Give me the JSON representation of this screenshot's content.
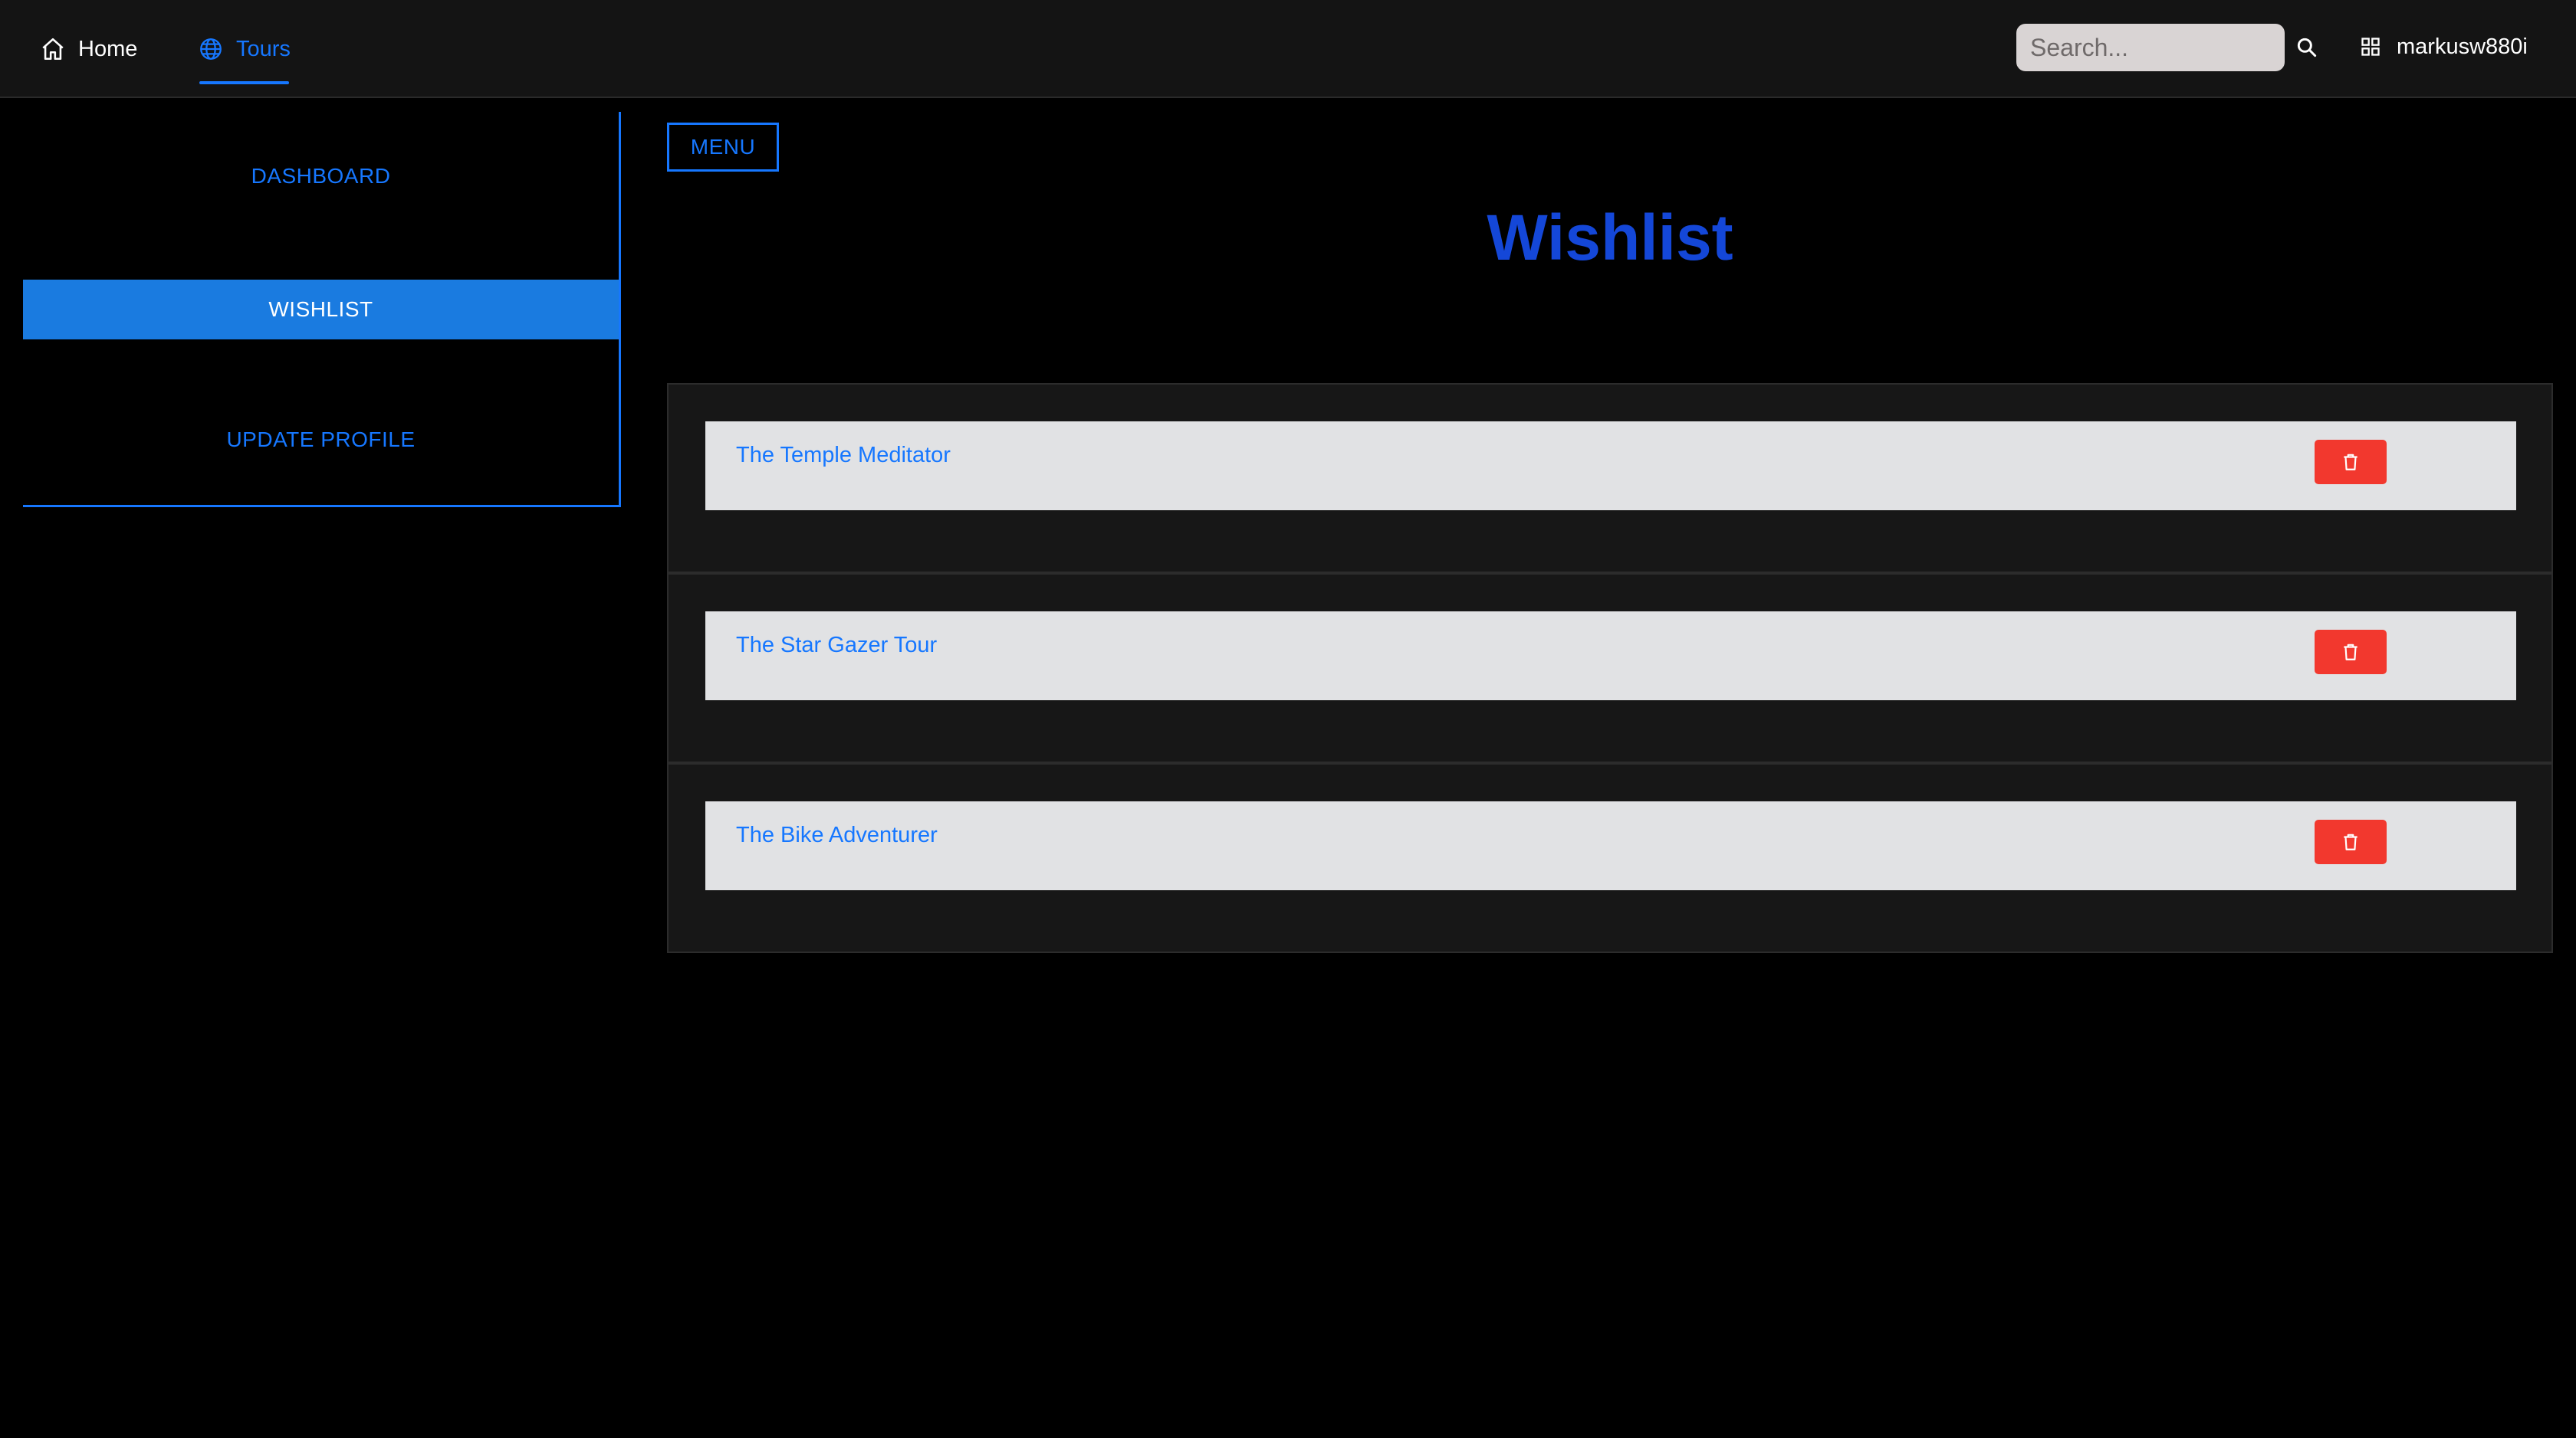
{
  "nav": {
    "home_label": "Home",
    "tours_label": "Tours",
    "search_placeholder": "Search...",
    "username": "markusw880i",
    "active_color": "#1677ff"
  },
  "sidebar": {
    "items": [
      {
        "label": "DASHBOARD",
        "active": false
      },
      {
        "label": "WISHLIST",
        "active": true
      },
      {
        "label": "UPDATE PROFILE",
        "active": false
      }
    ]
  },
  "main": {
    "menu_label": "MENU",
    "title": "Wishlist",
    "wishlist": [
      {
        "name": "The Temple Meditator"
      },
      {
        "name": "The Star Gazer Tour"
      },
      {
        "name": "The Bike Adventurer"
      }
    ]
  },
  "icons": {
    "home": "home-icon",
    "tours": "globe-icon",
    "search": "search-icon",
    "user": "grid-icon",
    "delete": "trash-icon"
  },
  "colors": {
    "accent": "#1677ff",
    "title": "#1447d8",
    "delete": "#f2382e",
    "card_bg": "#171717",
    "item_bg": "#e1e2e4"
  }
}
